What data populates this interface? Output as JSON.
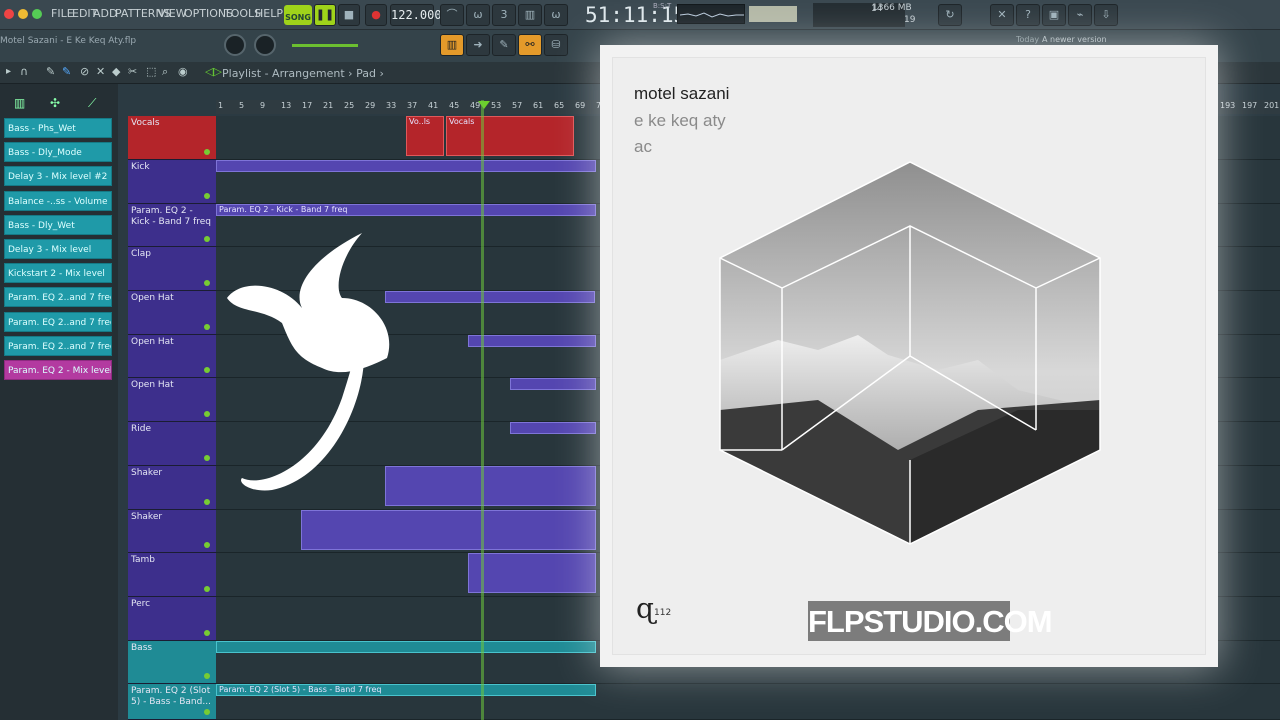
{
  "menu": [
    "FILE",
    "EDIT",
    "ADD",
    "PATTERNS",
    "VIEW",
    "OPTIONS",
    "TOOLS",
    "HELP"
  ],
  "transport": {
    "mode": "SONG",
    "tempo": "122.000",
    "time": "51:11:15",
    "time_unit": "B:S:T"
  },
  "cpu": {
    "value": "14",
    "memory": "1366 MB",
    "polyphony": "19"
  },
  "project": {
    "filename": "Motel Sazani - E Ke Keq Aty.flp"
  },
  "hint": {
    "pattern": "Pad",
    "news_label": "Today",
    "news_text": "A newer version"
  },
  "playlist": {
    "breadcrumb": "Playlist - Arrangement",
    "current": "Pad"
  },
  "ruler_ticks": [
    "1",
    "5",
    "9",
    "13",
    "17",
    "21",
    "25",
    "29",
    "33",
    "37",
    "41",
    "45",
    "49",
    "53",
    "57",
    "61",
    "65",
    "69",
    "73"
  ],
  "ruler_ticks_right": [
    "193",
    "197",
    "201"
  ],
  "browser_items": [
    {
      "label": "Bass - Phs_Wet",
      "color": "teal"
    },
    {
      "label": "Bass - Dly_Mode",
      "color": "teal"
    },
    {
      "label": "Delay 3 - Mix level #2",
      "color": "teal"
    },
    {
      "label": "Balance -..ss - Volume",
      "color": "teal"
    },
    {
      "label": "Bass - Dly_Wet",
      "color": "teal"
    },
    {
      "label": "Delay 3 - Mix level",
      "color": "teal"
    },
    {
      "label": "Kickstart 2 - Mix level",
      "color": "teal"
    },
    {
      "label": "Param. EQ 2..and 7 freq",
      "color": "teal"
    },
    {
      "label": "Param. EQ 2..and 7 freq",
      "color": "teal"
    },
    {
      "label": "Param. EQ 2..and 7 freq",
      "color": "teal"
    },
    {
      "label": "Param. EQ 2 - Mix level",
      "color": "pink"
    }
  ],
  "tracks": [
    {
      "name": "Vocals",
      "color": "#b4252a"
    },
    {
      "name": "Kick",
      "color": "#3d2f8c"
    },
    {
      "name": "Param. EQ 2 - Kick - Band 7 freq",
      "color": "#3d2f8c"
    },
    {
      "name": "Clap",
      "color": "#3d2f8c"
    },
    {
      "name": "Open Hat",
      "color": "#3d2f8c"
    },
    {
      "name": "Open Hat",
      "color": "#3d2f8c"
    },
    {
      "name": "Open Hat",
      "color": "#3d2f8c"
    },
    {
      "name": "Ride",
      "color": "#3d2f8c"
    },
    {
      "name": "Shaker",
      "color": "#3d2f8c"
    },
    {
      "name": "Shaker",
      "color": "#3d2f8c"
    },
    {
      "name": "Tamb",
      "color": "#3d2f8c"
    },
    {
      "name": "Perc",
      "color": "#3d2f8c"
    },
    {
      "name": "Bass",
      "color": "#1f8b95"
    },
    {
      "name": "Param. EQ 2 (Slot 5) - Bass - Band...",
      "color": "#1f8b95"
    }
  ],
  "clips": {
    "vocals_short": "Vo..ls",
    "vocals": "Vocals",
    "kick_automation": "Param. EQ 2 - Kick - Band 7 freq",
    "bass_automation": "Param. EQ 2 (Slot 5) - Bass - Band 7 freq"
  },
  "cover": {
    "artist": "motel sazani",
    "title": "e ke keq aty",
    "label": "ac",
    "catalog": "112",
    "watermark": "FLPSTUDIO.COM"
  },
  "colors": {
    "accent_green": "#9fd31a",
    "track_purple": "#3d2f8c",
    "track_red": "#b4252a",
    "track_teal": "#1f8b95"
  }
}
